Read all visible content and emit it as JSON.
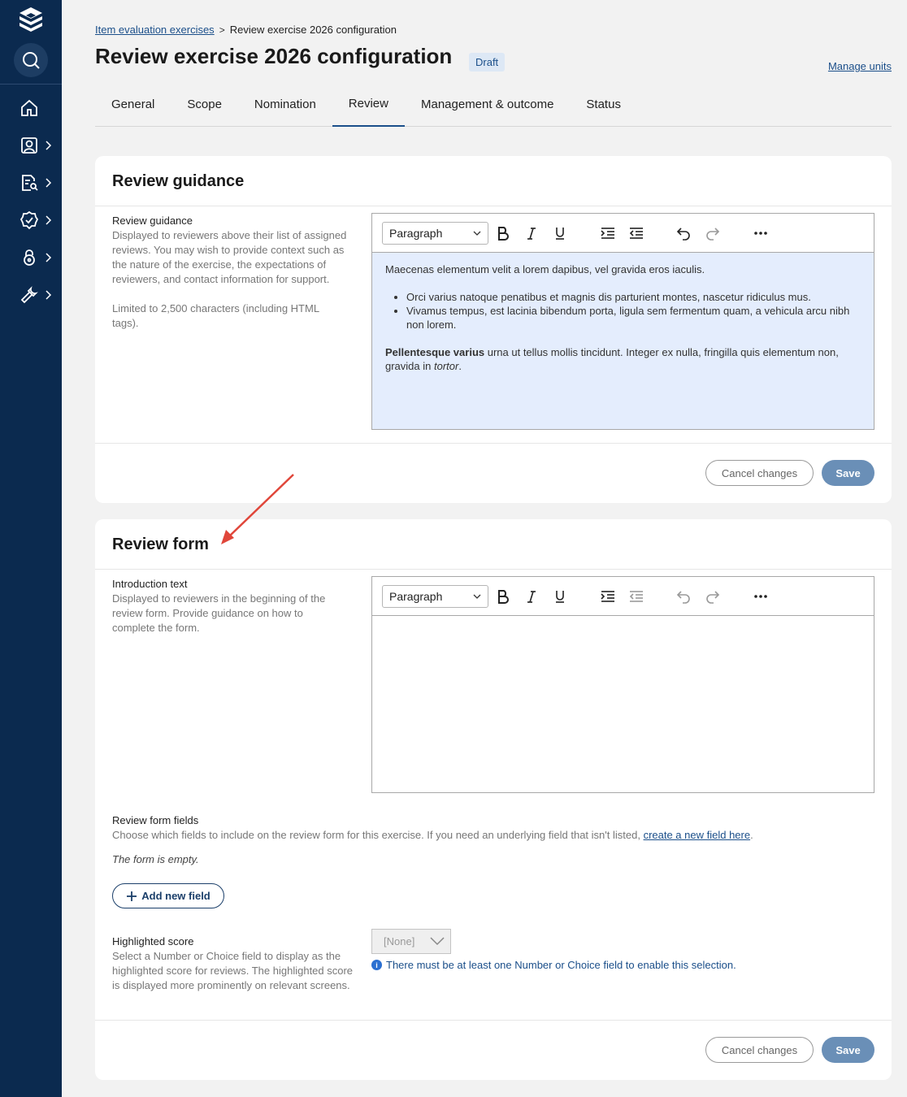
{
  "breadcrumb": {
    "parent": "Item evaluation exercises",
    "separator": ">",
    "current": "Review exercise 2026 configuration"
  },
  "header": {
    "title": "Review exercise 2026 configuration",
    "status_badge": "Draft",
    "manage_units": "Manage units"
  },
  "tabs": [
    {
      "label": "General",
      "active": false
    },
    {
      "label": "Scope",
      "active": false
    },
    {
      "label": "Nomination",
      "active": false
    },
    {
      "label": "Review",
      "active": true
    },
    {
      "label": "Management & outcome",
      "active": false
    },
    {
      "label": "Status",
      "active": false
    }
  ],
  "sidebar": {
    "items": [
      {
        "icon": "home-icon"
      },
      {
        "icon": "profile-icon"
      },
      {
        "icon": "document-search-icon"
      },
      {
        "icon": "badge-check-icon"
      },
      {
        "icon": "lock-icon"
      },
      {
        "icon": "wrench-icon"
      }
    ]
  },
  "guidance_card": {
    "title": "Review guidance",
    "field_label": "Review guidance",
    "field_help": "Displayed to reviewers above their list of assigned reviews. You may wish to provide context such as the nature of the exercise, the expectations of reviewers, and contact information for support.",
    "field_limit": "Limited to 2,500 characters (including HTML tags).",
    "editor": {
      "format": "Paragraph",
      "paragraph1": "Maecenas elementum velit a lorem dapibus, vel gravida eros iaculis.",
      "bullets": [
        "Orci varius natoque penatibus et magnis dis parturient montes, nascetur ridiculus mus.",
        "Vivamus tempus, est lacinia bibendum porta, ligula sem fermentum quam, a vehicula arcu nibh non lorem."
      ],
      "paragraph2_bold": "Pellentesque varius",
      "paragraph2_text": " urna ut tellus mollis tincidunt. Integer ex nulla, fringilla quis elementum non, gravida in ",
      "paragraph2_italic": "tortor",
      "paragraph2_end": "."
    },
    "cancel": "Cancel changes",
    "save": "Save"
  },
  "form_card": {
    "title": "Review form",
    "intro_label": "Introduction text",
    "intro_help": "Displayed to reviewers in the beginning of the review form. Provide guidance on how to complete the form.",
    "editor_format": "Paragraph",
    "fields_label": "Review form fields",
    "fields_help_prefix": "Choose which fields to include on the review form for this exercise. If you need an underlying field that isn't listed, ",
    "fields_help_link": "create a new field here",
    "fields_help_suffix": ".",
    "empty_text": "The form is empty.",
    "add_field": "Add new field",
    "score_label": "Highlighted score",
    "score_help": "Select a Number or Choice field to display as the highlighted score for reviews. The highlighted score is displayed more prominently on relevant screens.",
    "score_select_value": "[None]",
    "score_info": "There must be at least one Number or Choice field to enable this selection.",
    "cancel": "Cancel changes",
    "save": "Save"
  },
  "colors": {
    "sidebar": "#0b2a4f",
    "accent": "#1b4f8a",
    "save_button": "#6a8fb7",
    "editor_highlight": "#e4edfd",
    "annotation_arrow": "#e0463a"
  }
}
